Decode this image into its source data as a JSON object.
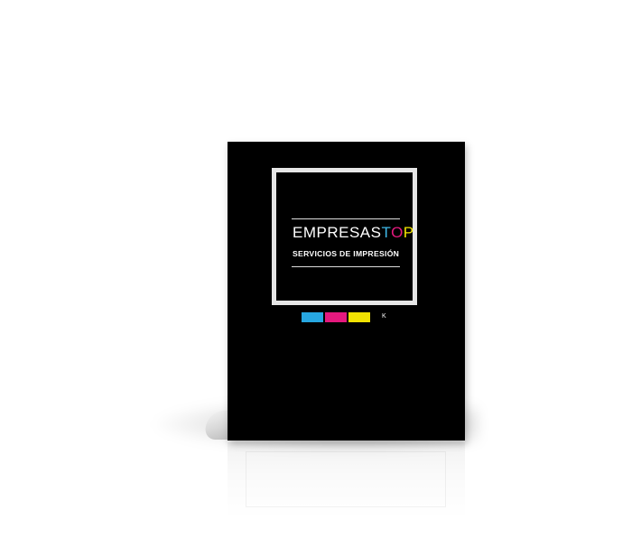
{
  "product": {
    "brand": {
      "part1": "EMPRESAS",
      "part_t": "T",
      "part_o": "O",
      "part_p": "P"
    },
    "tagline": "SERVICIOS DE IMPRESIÓN",
    "swatch_k_label": "K"
  },
  "colors": {
    "folder": "#000000",
    "cyan": "#27a7e1",
    "magenta": "#e5197e",
    "yellow": "#f1e202",
    "frame": "#e6e6e6"
  }
}
